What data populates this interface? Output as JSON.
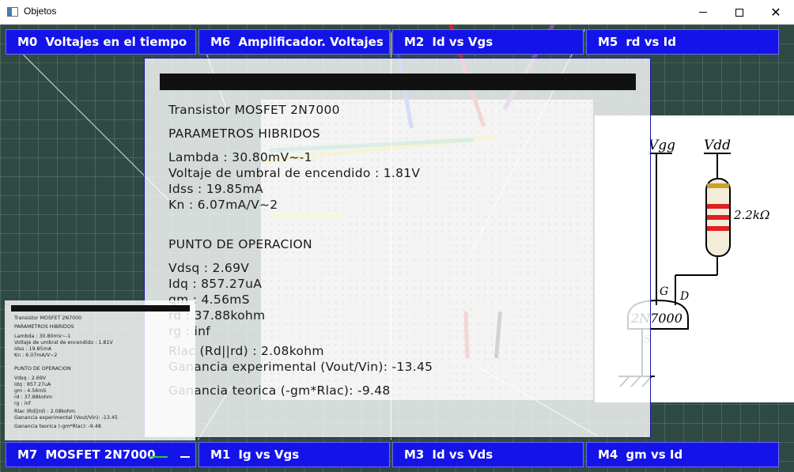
{
  "window": {
    "title": "Objetos",
    "icon": "app-window-icon"
  },
  "controls": {
    "minimize": "minimize-icon",
    "maximize": "maximize-icon",
    "close": "✕"
  },
  "top_tabs": [
    {
      "code": "M0",
      "label": "Voltajes en el tiempo"
    },
    {
      "code": "M6",
      "label": "Amplificador. Voltajes"
    },
    {
      "code": "M2",
      "label": "Id vs Vgs"
    },
    {
      "code": "M5",
      "label": "rd vs Id"
    }
  ],
  "bottom_tabs": [
    {
      "code": "M7",
      "label": "MOSFET 2N7000"
    },
    {
      "code": "M1",
      "label": "Ig vs Vgs"
    },
    {
      "code": "M3",
      "label": "Id vs Vds"
    },
    {
      "code": "M4",
      "label": "gm vs Id"
    }
  ],
  "panel": {
    "lines": [
      "Transistor MOSFET 2N7000",
      "PARAMETROS HIBRIDOS",
      "Lambda : 30.80mV~-1",
      "Voltaje de umbral de encendido : 1.81V",
      "Idss : 19.85mA",
      "Kn : 6.07mA/V~2",
      "PUNTO DE OPERACION",
      "Vdsq : 2.69V",
      "Idq : 857.27uA",
      "gm : 4.56mS",
      "rd : 37.88kohm",
      "rg : inf",
      "Rlac (Rd||rd) : 2.08kohm",
      "Ganancia experimental (Vout/Vin): -13.45",
      "Ganancia teorica (-gm*Rlac): -9.48"
    ]
  },
  "mini_panel": {
    "lines": [
      "Transistor MOSFET 2N7000",
      "PARAMETROS HIBRIDOS",
      "Lambda : 30.80mV~-1",
      "Voltaje de umbral de encendido : 1.81V",
      "Idss : 19.85mA",
      "Kn : 6.07mA/V~2",
      "PUNTO DE OPERACION",
      "Vdsq : 2.69V",
      "Idq : 857.27uA",
      "gm : 4.56mS",
      "rd : 37.88kohm",
      "rg : inf",
      "Rlac (Rd||rd) : 2.08kohm",
      "Ganancia experimental (Vout/Vin): -13.45",
      "Ganancia teorica (-gm*Rlac): -9.48"
    ]
  },
  "schematic": {
    "vgg": "Vgg",
    "vdd": "Vdd",
    "resistor": "2.2kΩ",
    "gate": "G",
    "drain": "D",
    "source": "S",
    "part": "2N7000"
  },
  "colors": {
    "tab_bg": "#1414e8",
    "tab_text": "#ffffff",
    "panel_border": "#1a1aa0"
  }
}
